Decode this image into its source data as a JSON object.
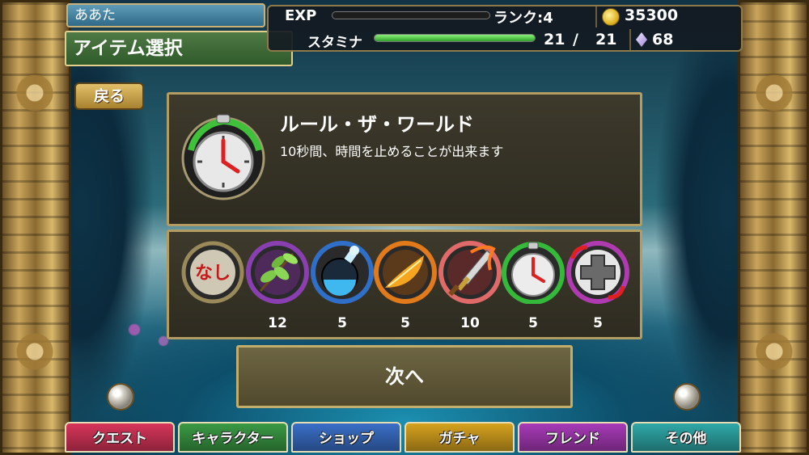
{
  "player": {
    "name": "ああた"
  },
  "screen": {
    "title": "アイテム選択",
    "back_label": "戻る"
  },
  "status": {
    "exp_label": "EXP",
    "exp_progress": 0.0,
    "rank_label": "ランク:4",
    "gold": "35300",
    "stamina_label": "スタミナ",
    "stamina_current": "21",
    "stamina_sep": "/",
    "stamina_max": "21",
    "stamina_progress": 1.0,
    "crystals": "68"
  },
  "selected_item": {
    "name": "ルール・ザ・ワールド",
    "description": "10秒間、時間を止めることが出来ます",
    "icon": "stopwatch-icon"
  },
  "items": [
    {
      "icon": "none-icon",
      "label": "なし",
      "count": "",
      "ring": "#9a8a5a"
    },
    {
      "icon": "herb-leaf-icon",
      "count": "12",
      "ring": "#8a3fb0"
    },
    {
      "icon": "blue-potion-bomb-icon",
      "count": "5",
      "ring": "#2f6fc8"
    },
    {
      "icon": "phoenix-feather-icon",
      "count": "5",
      "ring": "#e07a1a"
    },
    {
      "icon": "flaming-sword-icon",
      "count": "10",
      "ring": "#e06a6a"
    },
    {
      "icon": "stopwatch-icon",
      "count": "5",
      "ring": "#35b93a"
    },
    {
      "icon": "swap-cross-icon",
      "count": "5",
      "ring": "#b03ab0"
    }
  ],
  "next_label": "次へ",
  "nav": [
    {
      "label": "クエスト",
      "color": "#d8355a"
    },
    {
      "label": "キャラクター",
      "color": "#3a9a44"
    },
    {
      "label": "ショップ",
      "color": "#3a6fc8"
    },
    {
      "label": "ガチャ",
      "color": "#d6a21e"
    },
    {
      "label": "フレンド",
      "color": "#a83ab8"
    },
    {
      "label": "その他",
      "color": "#2fa8a8"
    }
  ]
}
